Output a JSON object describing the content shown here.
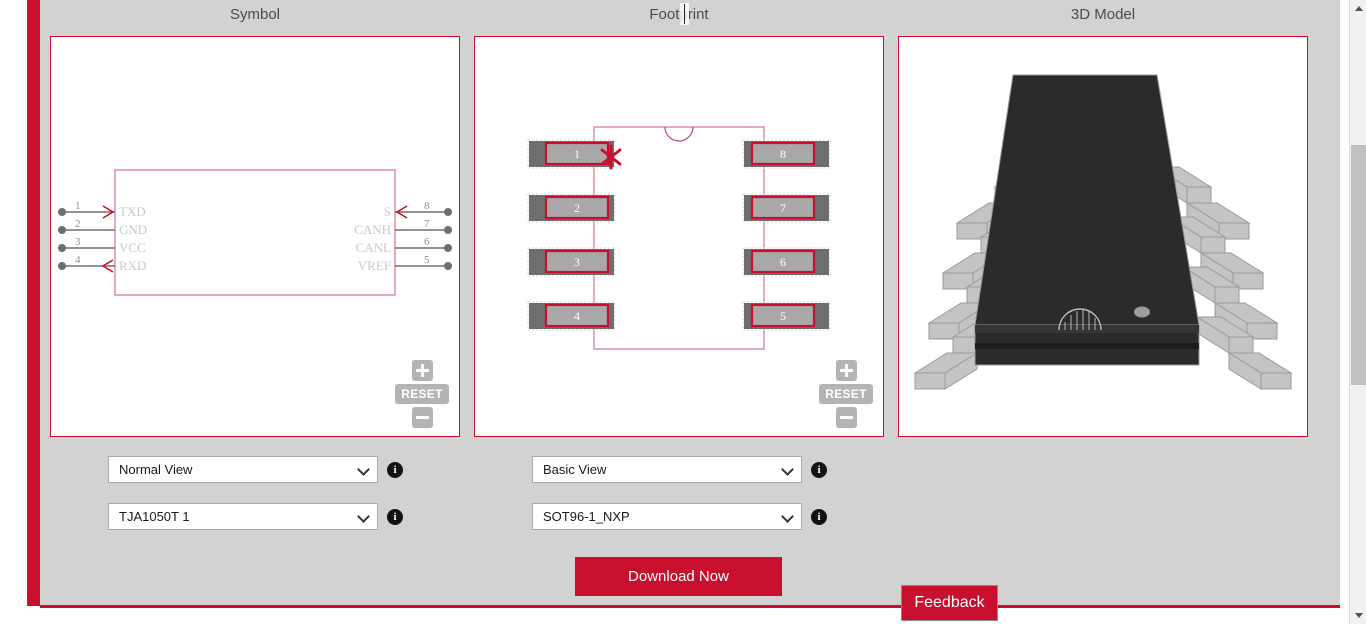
{
  "headers": {
    "symbol": "Symbol",
    "footprint": "Footprint",
    "model3d": "3D Model"
  },
  "colors": {
    "brand_red": "#c8102e",
    "page_bg": "#d2d2d2",
    "panel_bg": "#ffffff",
    "pad_gray": "#6e6e6e",
    "pad_inner": "#a8a8a8",
    "body_black": "#2b2b2b",
    "lead_gray": "#c4c4c4"
  },
  "symbol": {
    "left_pins": [
      {
        "number": "1",
        "label": "TXD",
        "arrow": "in"
      },
      {
        "number": "2",
        "label": "GND",
        "arrow": "none"
      },
      {
        "number": "3",
        "label": "VCC",
        "arrow": "none"
      },
      {
        "number": "4",
        "label": "RXD",
        "arrow": "out"
      }
    ],
    "right_pins": [
      {
        "number": "8",
        "label": "S",
        "arrow": "in"
      },
      {
        "number": "7",
        "label": "CANH",
        "arrow": "none"
      },
      {
        "number": "6",
        "label": "CANL",
        "arrow": "none"
      },
      {
        "number": "5",
        "label": "VREF",
        "arrow": "none"
      }
    ],
    "zoom": {
      "plus": "+",
      "reset": "RESET",
      "minus": "-"
    },
    "view_select": {
      "value": "Normal View"
    },
    "part_select": {
      "value": "TJA1050T 1"
    }
  },
  "footprint": {
    "left_pads": [
      "1",
      "2",
      "3",
      "4"
    ],
    "right_pads": [
      "8",
      "7",
      "6",
      "5"
    ],
    "pin1_marker": "asterisk",
    "zoom": {
      "plus": "+",
      "reset": "RESET",
      "minus": "-"
    },
    "view_select": {
      "value": "Basic View"
    },
    "package_select": {
      "value": "SOT96-1_NXP"
    }
  },
  "model3d": {
    "package_type": "SOIC-8",
    "lead_count": 8
  },
  "actions": {
    "download": "Download Now",
    "feedback": "Feedback"
  },
  "scrollbar": {
    "up_arrow": "▲",
    "down_arrow": "▼"
  }
}
